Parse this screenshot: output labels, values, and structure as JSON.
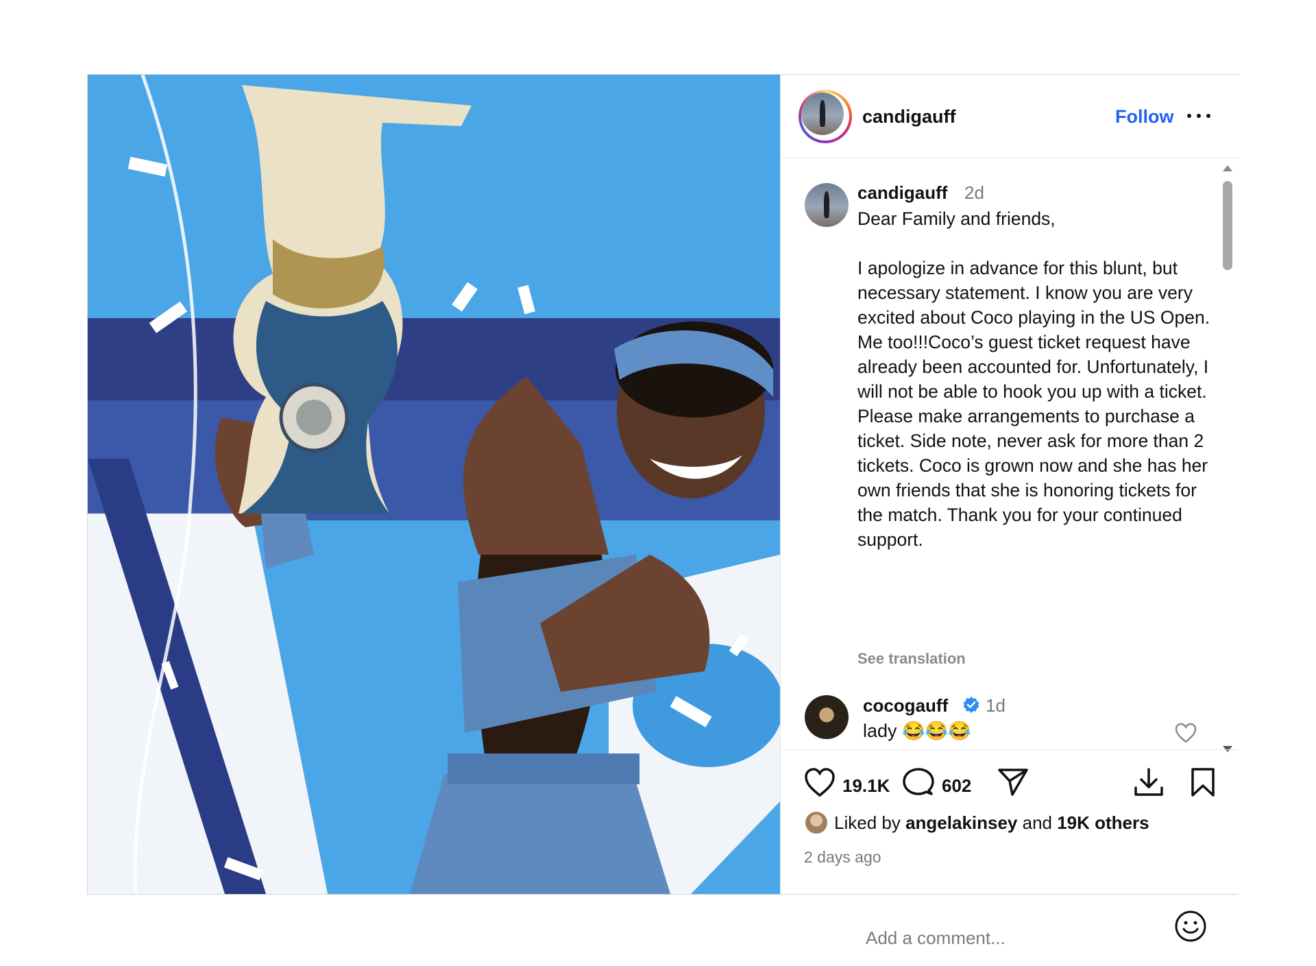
{
  "post": {
    "author": "candigauff",
    "follow_label": "Follow",
    "more_icon": "more-horizontal-icon",
    "image_alt": "Photo of a tennis player holding a trophy"
  },
  "caption": {
    "username": "candigauff",
    "time": "2d",
    "text": "Dear Family and friends,\n\nI apologize in advance for this blunt, but necessary statement. I know you are very excited about Coco playing in the US Open. Me too!!!Coco’s guest ticket request have already been accounted for. Unfortunately, I will not be able to hook you up with a ticket. Please make arrangements to purchase a ticket. Side note, never ask for more than 2 tickets. Coco is grown now and she has her own friends that she is honoring tickets for the match. Thank you for your continued support.",
    "see_translation": "See translation"
  },
  "comments": [
    {
      "username": "cocogauff",
      "verified": true,
      "time": "1d",
      "text": "lady 😂😂😂"
    }
  ],
  "actions": {
    "like_count": "19.1K",
    "comment_count": "602"
  },
  "likes": {
    "prefix": "Liked by ",
    "user": "angelakinsey",
    "middle": " and ",
    "others": "19K others"
  },
  "time_ago": "2 days ago",
  "comment_input": {
    "placeholder": "Add a comment..."
  },
  "colors": {
    "accent": "#1f63f0",
    "verified": "#2f8cf0",
    "text": "#111111",
    "muted": "#777777"
  }
}
